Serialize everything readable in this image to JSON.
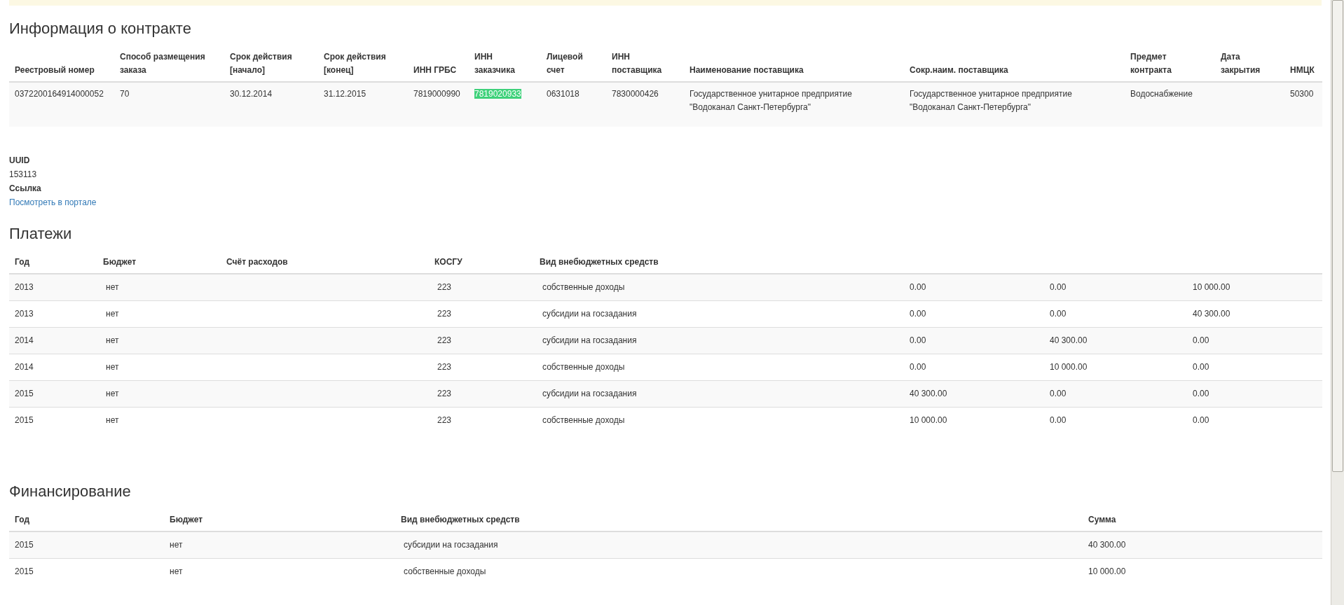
{
  "contract": {
    "title": "Информация о контракте",
    "columns": [
      "Реестровый номер",
      "Способ размещения заказа",
      "Срок действия [начало]",
      "Срок действия [конец]",
      "ИНН ГРБС",
      "ИНН заказчика",
      "Лицевой счет",
      "ИНН поставщика",
      "Наименование поставщика",
      "Сокр.наим. поставщика",
      "Предмет контракта",
      "Дата закрытия",
      "НМЦК"
    ],
    "rows": [
      {
        "cells": [
          {
            "text": "0372200164914000052"
          },
          {
            "text": "70"
          },
          {
            "text": "30.12.2014"
          },
          {
            "text": "31.12.2015"
          },
          {
            "text": "7819000990"
          },
          {
            "text": "7819020933",
            "highlighted": true
          },
          {
            "text": "0631018"
          },
          {
            "text": "7830000426"
          },
          {
            "text": "Государственное унитарное предприятие \"Водоканал Санкт-Петербурга\""
          },
          {
            "text": "Государственное унитарное предприятие \"Водоканал Санкт-Петербурга\""
          },
          {
            "text": "Водоснабжение"
          },
          {},
          {
            "text": "50300"
          }
        ]
      }
    ]
  },
  "details": [
    {
      "label": "UUID",
      "value": "153113",
      "kind": "text"
    },
    {
      "label": "Ссылка",
      "value": "Посмотреть в портале",
      "kind": "link"
    }
  ],
  "payments": {
    "title": "Платежи",
    "columns": [
      "Год",
      "Бюджет",
      "Счёт расходов",
      "КОСГУ",
      "Вид внебюджетных средств",
      "",
      "",
      ""
    ],
    "rows": [
      [
        "2013",
        "нет",
        "",
        "223",
        "собственные доходы",
        "0.00",
        "0.00",
        "10 000.00"
      ],
      [
        "2013",
        "нет",
        "",
        "223",
        "субсидии на госзадания",
        "0.00",
        "0.00",
        "40 300.00"
      ],
      [
        "2014",
        "нет",
        "",
        "223",
        "субсидии на госзадания",
        "0.00",
        "40 300.00",
        "0.00"
      ],
      [
        "2014",
        "нет",
        "",
        "223",
        "собственные доходы",
        "0.00",
        "10 000.00",
        "0.00"
      ],
      [
        "2015",
        "нет",
        "",
        "223",
        "субсидии на госзадания",
        "40 300.00",
        "0.00",
        "0.00"
      ],
      [
        "2015",
        "нет",
        "",
        "223",
        "собственные доходы",
        "10 000.00",
        "0.00",
        "0.00"
      ]
    ]
  },
  "financing": {
    "title": "Финансирование",
    "columns": [
      "Год",
      "Бюджет",
      "Вид внебюджетных средств",
      "Сумма"
    ],
    "rows": [
      [
        "2015",
        "нет",
        "субсидии на госзадания",
        "40 300.00"
      ],
      [
        "2015",
        "нет",
        "собственные доходы",
        "10 000.00"
      ]
    ]
  }
}
